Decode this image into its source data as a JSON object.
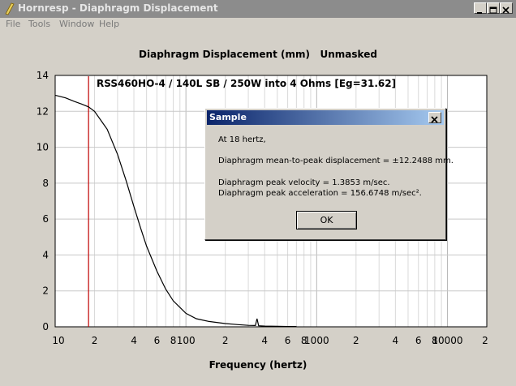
{
  "window": {
    "title": "Hornresp - Diaphragm Displacement",
    "controls": [
      "minimize",
      "maximize",
      "close"
    ]
  },
  "menu": [
    "File",
    "Tools",
    "Window",
    "Help"
  ],
  "plot": {
    "title": "Diaphragm Displacement (mm)   Unmasked",
    "caption": "RSS460HO-4 / 140L SB / 250W into 4 Ohms [Eg=31.62]",
    "xlabel": "Frequency (hertz)"
  },
  "chart_data": {
    "type": "line",
    "title": "Diaphragm Displacement (mm)   Unmasked",
    "xlabel": "Frequency (hertz)",
    "ylabel": "",
    "x_scale": "log",
    "xlim": [
      10,
      20000
    ],
    "ylim": [
      0,
      14
    ],
    "x_tick_labels": [
      "10",
      "2",
      "4",
      "6",
      "8",
      "100",
      "2",
      "4",
      "6",
      "8",
      "1000",
      "2",
      "4",
      "6",
      "8",
      "10000",
      "2"
    ],
    "y_ticks": [
      0,
      2,
      4,
      6,
      8,
      10,
      12,
      14
    ],
    "grid": true,
    "marker_frequency": 18,
    "series": [
      {
        "name": "",
        "x": [
          10,
          12,
          14,
          16,
          18,
          20,
          25,
          30,
          35,
          40,
          45,
          50,
          60,
          70,
          80,
          100,
          120,
          150,
          200,
          250,
          300,
          340,
          350,
          360,
          400,
          500,
          600,
          700
        ],
        "y": [
          12.9,
          12.75,
          12.55,
          12.4,
          12.25,
          12.0,
          11.0,
          9.6,
          8.1,
          6.7,
          5.5,
          4.5,
          3.1,
          2.1,
          1.45,
          0.75,
          0.45,
          0.3,
          0.18,
          0.12,
          0.08,
          0.07,
          0.45,
          0.06,
          0.04,
          0.03,
          0.02,
          0.02
        ]
      }
    ]
  },
  "dialog": {
    "title": "Sample",
    "line1": "At 18 hertz,",
    "line2": "Diaphragm mean-to-peak displacement = ±12.2488 mm.",
    "line3": "Diaphragm peak velocity = 1.3853 m/sec.",
    "line4": "Diaphragm peak acceleration = 156.6748 m/sec².",
    "ok_label": "OK"
  },
  "colors": {
    "curve": "#000000",
    "marker_line": "#c00000",
    "grid": "#d9d9d9"
  }
}
